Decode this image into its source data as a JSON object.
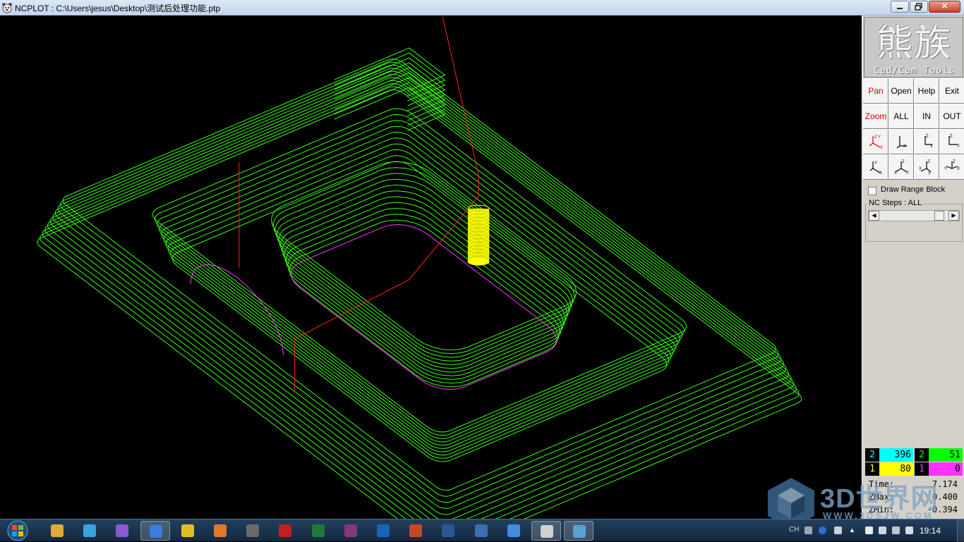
{
  "window": {
    "title": "NCPLOT : C:\\Users\\jesus\\Desktop\\测试后处理功能.ptp",
    "minimize_icon": "minimize-icon",
    "maximize_icon": "maximize-icon",
    "close_label": "✕"
  },
  "logo": {
    "chinese": "熊族",
    "english": "Cad/Cam Tools"
  },
  "toolbar": {
    "row1": [
      "Pan",
      "Open",
      "Help",
      "Exit"
    ],
    "row2": [
      "Zoom",
      "ALL",
      "IN",
      "OUT"
    ],
    "view_icons": [
      "view-iso-xyz-icon",
      "view-top-xy-icon",
      "view-front-xz-icon",
      "view-side-yz-icon",
      "view-iso-yx-icon",
      "view-iso-zxy-icon",
      "view-iso-xzy-icon",
      "view-iso-yzx-icon"
    ]
  },
  "options": {
    "draw_range_block": "Draw Range Block",
    "draw_range_checked": false,
    "nc_steps_label": "NC Steps : ALL",
    "nc_steps_fraction": 0.93
  },
  "legend": [
    {
      "tool": "2",
      "count": "396",
      "color": "#00ffff"
    },
    {
      "tool": "2",
      "count": "51",
      "color": "#00ff00"
    },
    {
      "tool": "1",
      "count": "80",
      "color": "#ffff00"
    },
    {
      "tool": "1",
      "count": "0",
      "color": "#ff00ff"
    }
  ],
  "stats": [
    {
      "key": "Time:",
      "value": "7.174"
    },
    {
      "key": "ZMax:",
      "value": "0.400"
    },
    {
      "key": "ZMin:",
      "value": "-0.394"
    }
  ],
  "toolpath_colors": {
    "contour": "#39ff14",
    "rapid": "#ff2020",
    "cyan_path": "#00ffff",
    "magenta_path": "#ff33ff",
    "tool": "#ffff00"
  },
  "taskbar": {
    "items": [
      "start-orb-icon",
      "explorer-icon",
      "ie-icon",
      "media-app-icon",
      "browser-icon",
      "chrome-icon",
      "powerpoint-viewer-icon",
      "file-manager-icon",
      "mastercam-icon",
      "excel-icon",
      "onenote-icon",
      "outlook-icon",
      "powerpoint-icon",
      "word-icon",
      "network-icon",
      "app-bird-icon",
      "ncplot-icon",
      "paint-icon"
    ],
    "tray_language": "CH",
    "clock": "19:14"
  },
  "watermark": {
    "text": "3D世界网",
    "url": "WWW.3DSJW.COM"
  }
}
